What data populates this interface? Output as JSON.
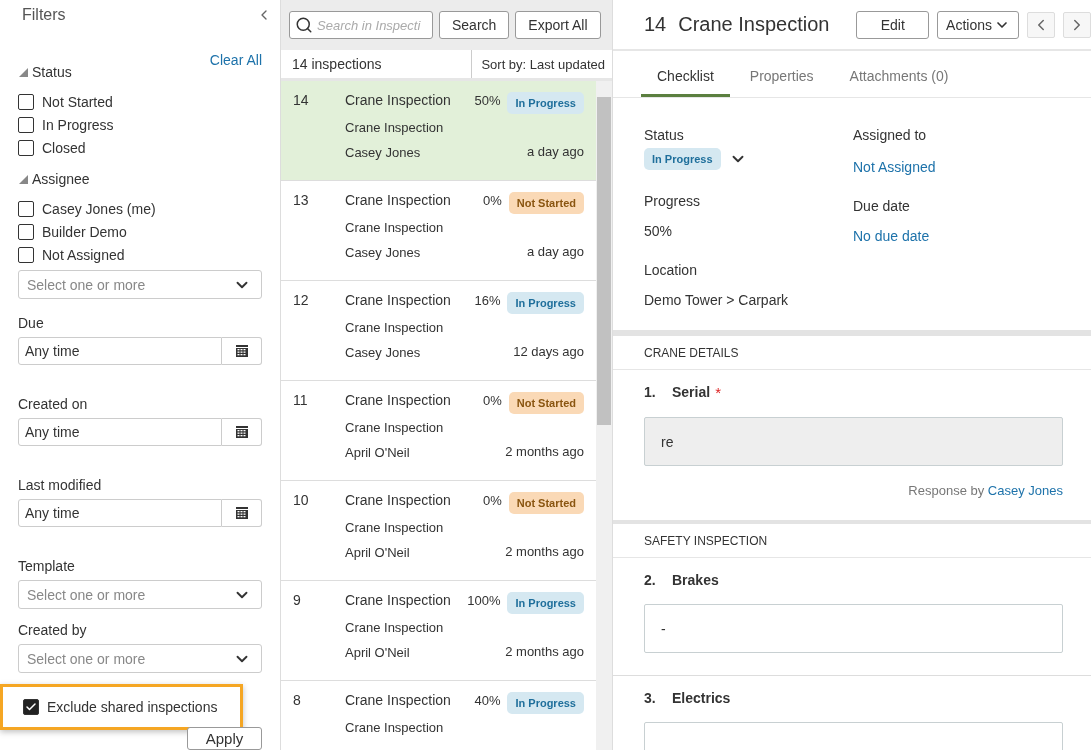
{
  "filters": {
    "title": "Filters",
    "clear_all": "Clear All",
    "groups": [
      {
        "label": "Status",
        "expanded": true,
        "options": [
          {
            "label": "Not Started",
            "checked": false
          },
          {
            "label": "In Progress",
            "checked": false
          },
          {
            "label": "Closed",
            "checked": false
          }
        ]
      },
      {
        "label": "Assignee",
        "expanded": true,
        "options": [
          {
            "label": "Casey Jones (me)",
            "checked": false
          },
          {
            "label": "Builder Demo",
            "checked": false
          },
          {
            "label": "Not Assigned",
            "checked": false
          }
        ],
        "select_placeholder": "Select one or more"
      }
    ],
    "fields": [
      {
        "kind": "date",
        "label": "Due",
        "value": "Any time"
      },
      {
        "kind": "date",
        "label": "Created on",
        "value": "Any time"
      },
      {
        "kind": "date",
        "label": "Last modified",
        "value": "Any time"
      },
      {
        "kind": "select",
        "label": "Template",
        "placeholder": "Select one or more"
      },
      {
        "kind": "select",
        "label": "Created by",
        "placeholder": "Select one or more"
      }
    ],
    "exclude_shared": {
      "label": "Exclude shared inspections",
      "checked": true,
      "highlighted": true
    },
    "apply": "Apply"
  },
  "list": {
    "search_placeholder": "Search in Inspecti",
    "search_button": "Search",
    "export_button": "Export All",
    "count": "14 inspections",
    "sort": "Sort by: Last updated",
    "rows": [
      {
        "number": "14",
        "title": "Crane Inspection",
        "template": "Crane Inspection",
        "assignee": "Casey Jones",
        "progress": "50%",
        "status": {
          "kind": "in_progress",
          "label": "In Progress"
        },
        "time": "a day ago",
        "selected": true
      },
      {
        "number": "13",
        "title": "Crane Inspection",
        "template": "Crane Inspection",
        "assignee": "Casey Jones",
        "progress": "0%",
        "status": {
          "kind": "not_started",
          "label": "Not Started"
        },
        "time": "a day ago",
        "selected": false
      },
      {
        "number": "12",
        "title": "Crane Inspection",
        "template": "Crane Inspection",
        "assignee": "Casey Jones",
        "progress": "16%",
        "status": {
          "kind": "in_progress",
          "label": "In Progress"
        },
        "time": "12 days ago",
        "selected": false
      },
      {
        "number": "11",
        "title": "Crane Inspection",
        "template": "Crane Inspection",
        "assignee": "April O'Neil",
        "progress": "0%",
        "status": {
          "kind": "not_started",
          "label": "Not Started"
        },
        "time": "2 months ago",
        "selected": false
      },
      {
        "number": "10",
        "title": "Crane Inspection",
        "template": "Crane Inspection",
        "assignee": "April O'Neil",
        "progress": "0%",
        "status": {
          "kind": "not_started",
          "label": "Not Started"
        },
        "time": "2 months ago",
        "selected": false
      },
      {
        "number": "9",
        "title": "Crane Inspection",
        "template": "Crane Inspection",
        "assignee": "April O'Neil",
        "progress": "100%",
        "status": {
          "kind": "in_progress",
          "label": "In Progress"
        },
        "time": "2 months ago",
        "selected": false
      },
      {
        "number": "8",
        "title": "Crane Inspection",
        "template": "Crane Inspection",
        "progress": "40%",
        "status": {
          "kind": "in_progress",
          "label": "In Progress"
        },
        "selected": false
      }
    ]
  },
  "detail": {
    "number": "14",
    "title": "Crane Inspection",
    "edit": "Edit",
    "actions": "Actions",
    "tabs": [
      {
        "label": "Checklist",
        "selected": true
      },
      {
        "label": "Properties",
        "selected": false
      },
      {
        "label": "Attachments (0)",
        "selected": false
      }
    ],
    "status_label": "Status",
    "status": {
      "kind": "in_progress",
      "label": "In Progress"
    },
    "progress_label": "Progress",
    "progress": "50%",
    "location_label": "Location",
    "location": "Demo Tower > Carpark",
    "assigned_label": "Assigned to",
    "assigned": "Not Assigned",
    "due_label": "Due date",
    "due": "No due date",
    "sections": [
      {
        "title": "CRANE DETAILS",
        "questions": [
          {
            "number": "1.",
            "label": "Serial",
            "required_mark": "*",
            "answer": "re",
            "disabled": true,
            "response_prefix": "Response by",
            "response_by": "Casey Jones"
          }
        ]
      },
      {
        "title": "SAFETY INSPECTION",
        "questions": [
          {
            "number": "2.",
            "label": "Brakes",
            "answer": "-",
            "disabled": false
          },
          {
            "number": "3.",
            "label": "Electrics",
            "disabled": false
          }
        ]
      }
    ]
  }
}
